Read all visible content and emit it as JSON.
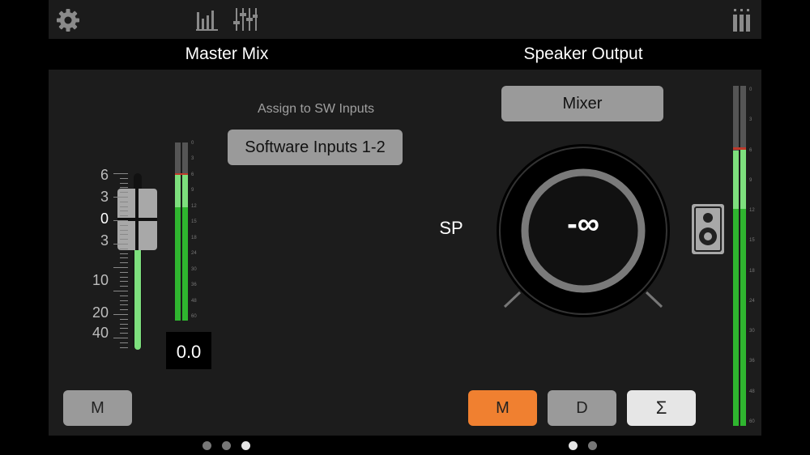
{
  "toolbar": {
    "settings_icon": "gear-icon",
    "meters_icon": "meter-bars-icon",
    "mixer_icon": "fader-sliders-icon",
    "channels_icon": "channel-strips-icon"
  },
  "master": {
    "header": "Master Mix",
    "assign_label": "Assign to SW Inputs",
    "assign_value": "Software Inputs 1-2",
    "fader_scale": [
      "6",
      "3",
      "0",
      "3",
      "10",
      "20",
      "40"
    ],
    "fader_value": "0.0",
    "mute_label": "M",
    "meter_left_level": 0.82,
    "meter_right_level": 0.82,
    "meter_ticks": [
      "0",
      "3",
      "6",
      "9",
      "12",
      "15",
      "18",
      "24",
      "30",
      "36",
      "48",
      "60"
    ]
  },
  "speaker": {
    "header": "Speaker Output",
    "source_button": "Mixer",
    "knob_label": "SP",
    "knob_value": "-∞",
    "speaker_icon": "speaker-icon",
    "mute_label": "M",
    "dim_label": "D",
    "mono_label": "Σ",
    "meter_left_level": 0.82,
    "meter_right_level": 0.82,
    "meter_ticks": [
      "0",
      "3",
      "6",
      "9",
      "12",
      "15",
      "18",
      "24",
      "30",
      "36",
      "48",
      "60"
    ]
  },
  "colors": {
    "accent_orange": "#f08030",
    "meter_green": "#2fb52f",
    "meter_light_green": "#7ddf7d",
    "peak_red": "#c0392b",
    "button_gray": "#9a9a9a",
    "button_light": "#e6e6e6"
  },
  "pagination": {
    "left_pages": 3,
    "left_active": 3,
    "right_pages": 2,
    "right_active": 1
  }
}
